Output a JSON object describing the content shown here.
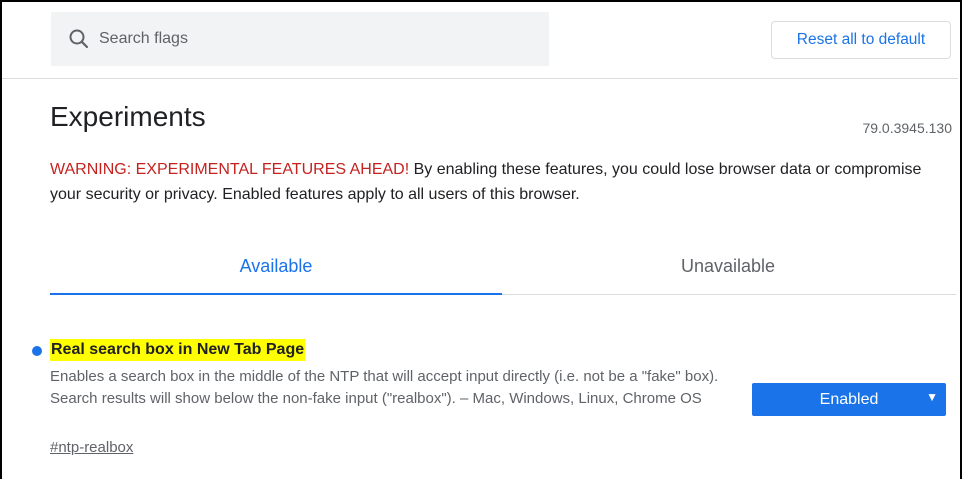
{
  "header": {
    "search": {
      "placeholder": "Search flags",
      "value": ""
    },
    "reset_label": "Reset all to default"
  },
  "page": {
    "title": "Experiments",
    "version": "79.0.3945.130",
    "warning_prefix": "WARNING: EXPERIMENTAL FEATURES AHEAD!",
    "warning_body": " By enabling these features, you could lose browser data or compromise your security or privacy. Enabled features apply to all users of this browser."
  },
  "tabs": [
    {
      "label": "Available",
      "selected": true
    },
    {
      "label": "Unavailable",
      "selected": false
    }
  ],
  "experiments": [
    {
      "title": "Real search box in New Tab Page",
      "description": "Enables a search box in the middle of the NTP that will accept input directly (i.e. not be a \"fake\" box). Search results will show below the non-fake input (\"realbox\"). – Mac, Windows, Linux, Chrome OS",
      "link": "#ntp-realbox",
      "selected_option": "Enabled"
    }
  ],
  "icons": {
    "search": "search-icon",
    "dropdown": "chevron-down-icon",
    "modified_indicator": "dot-icon"
  },
  "colors": {
    "accent": "#1a73e8",
    "warning": "#c5221f",
    "highlight": "#ffff00"
  }
}
